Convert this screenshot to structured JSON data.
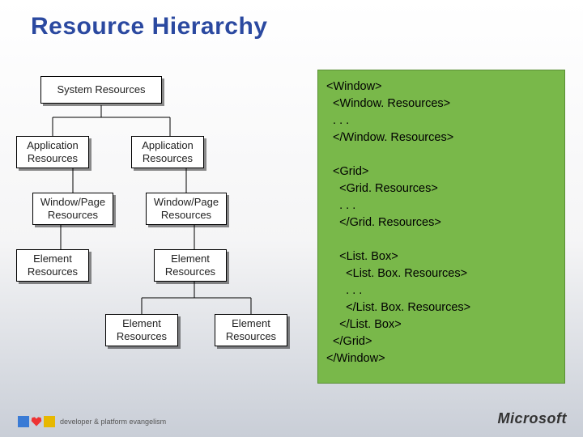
{
  "title": "Resource Hierarchy",
  "nodes": {
    "system": "System Resources",
    "app1": "Application\nResources",
    "app2": "Application\nResources",
    "wp1": "Window/Page\nResources",
    "wp2": "Window/Page\nResources",
    "el1": "Element\nResources",
    "el2": "Element\nResources",
    "el3": "Element\nResources",
    "el4": "Element\nResources"
  },
  "code": "<Window>\n  <Window. Resources>\n  . . .\n  </Window. Resources>\n\n  <Grid>\n    <Grid. Resources>\n    . . .\n    </Grid. Resources>\n\n    <List. Box>\n      <List. Box. Resources>\n      . . .\n      </List. Box. Resources>\n    </List. Box>\n  </Grid>\n</Window>",
  "footer": {
    "tagline": "developer & platform evangelism",
    "brand": "Microsoft"
  }
}
